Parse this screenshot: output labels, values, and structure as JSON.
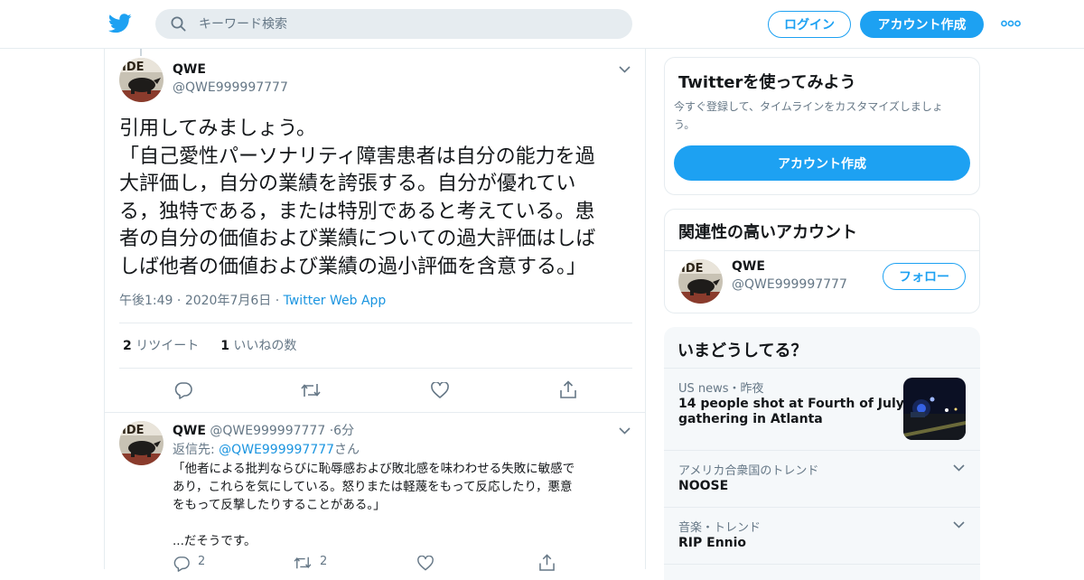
{
  "topbar": {
    "search_placeholder": "キーワード検索",
    "login_label": "ログイン",
    "signup_label": "アカウント作成"
  },
  "tweet": {
    "name": "QWE",
    "handle": "@QWE999997777",
    "text_lines": [
      "引用してみましょう。",
      "「自己愛性パーソナリティ障害患者は自分の能力を過",
      "大評価し，自分の業績を誇張する。自分が優れてい",
      "る，独特である，または特別であると考えている。患",
      "者の自分の価値および業績についての過大評価はしば",
      "しば他者の価値および業績の過小評価を含意する。」"
    ],
    "time": "午後1:49",
    "date": "2020年7月6日",
    "app": "Twitter Web App",
    "retweet_count": "2",
    "retweet_label": "リツイート",
    "like_count": "1",
    "like_label": "いいねの数"
  },
  "reply": {
    "name": "QWE",
    "handle": "@QWE999997777",
    "time": "6分",
    "reply_to_label": "返信先:",
    "reply_to_handle": "@QWE999997777",
    "reply_to_suffix": "さん",
    "text_lines": [
      "「他者による批判ならびに恥辱感および敗北感を味わわせる失敗に敏感で",
      "あり，これらを気にしている。怒りまたは軽蔑をもって反応したり，悪意",
      "をもって反撃したりすることがある。」",
      "",
      "...だそうです。"
    ],
    "reply_count": "2",
    "retweet_count": "2"
  },
  "sidebar": {
    "signup_card": {
      "title": "Twitterを使ってみよう",
      "subtitle_lines": [
        "今すぐ登録して、タイムラインをカスタマイズしましょ",
        "う。"
      ],
      "button_label": "アカウント作成"
    },
    "related": {
      "title": "関連性の高いアカウント",
      "name": "QWE",
      "handle": "@QWE999997777",
      "follow_label": "フォロー"
    },
    "trends": {
      "title": "いまどうしてる？",
      "items": [
        {
          "meta": "US news・昨夜",
          "name_lines": [
            "14 people shot at Fourth of July",
            "gathering in Atlanta"
          ]
        },
        {
          "meta": "アメリカ合衆国のトレンド",
          "name_lines": [
            "NOOSE"
          ]
        },
        {
          "meta": "音楽・トレンド",
          "name_lines": [
            "RIP Ennio"
          ]
        }
      ]
    }
  },
  "colors": {
    "brand": "#1da1f2",
    "link": "#1b95e0",
    "secondary_text": "#657786",
    "border": "#e6ecf0",
    "trends_bg": "#f5f8fa"
  }
}
